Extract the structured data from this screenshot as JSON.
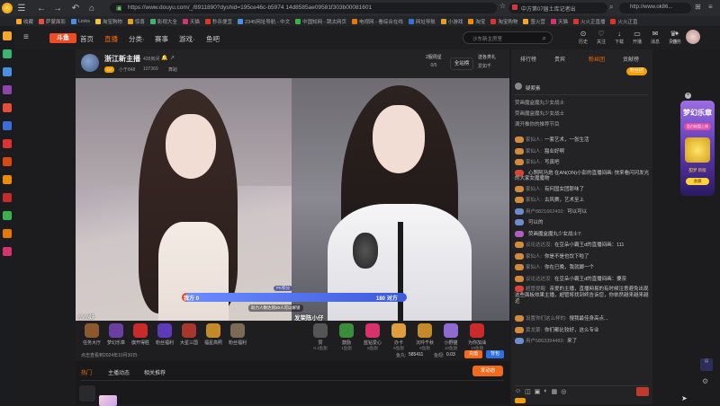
{
  "browser": {
    "url": "https://www.douyu.com/_/8911890?dyshid=195ce46c-b5974 14d8585ae09581f303b00081601",
    "search_placeholder": "中方第07届土库记者出",
    "ext_url": "http://www.ok86...",
    "bookmarks": [
      "收藏",
      "萨蒙面影",
      "Links",
      "淘宝购物",
      "惊喜",
      "影视大全",
      "天猫",
      "秒杀便宜",
      "2345网址导航 - 中文",
      "中国知网 - 跳太网页",
      "电视网 - 看综合在线",
      "网址导航",
      "小游戏",
      "淘宝",
      "淘宝购物",
      "萤火营",
      "天猫",
      "火火正直播",
      "火火正直"
    ]
  },
  "site": {
    "logo": "斗鱼",
    "nav": [
      {
        "label": "首页"
      },
      {
        "label": "直播"
      },
      {
        "label": "分类·"
      },
      {
        "label": "赛事"
      },
      {
        "label": "游戏·"
      },
      {
        "label": "鱼吧"
      }
    ],
    "search_placeholder": "沙东新主房室",
    "header_icons": [
      {
        "glyph": "⊙",
        "label": "历史"
      },
      {
        "glyph": "♡",
        "label": "关注"
      },
      {
        "glyph": "↓",
        "label": "下载"
      },
      {
        "glyph": "▭",
        "label": "开播"
      },
      {
        "glyph": "✉",
        "label": "消息"
      },
      {
        "glyph": "♛",
        "label": "贵族"
      },
      {
        "glyph": "✦",
        "label": "任务"
      }
    ]
  },
  "streamer": {
    "name": "浙江新主播",
    "room_num": "438房间",
    "followers": "小于848",
    "hot": "107369",
    "tag": "舞蹈",
    "rank_label": "2服周星",
    "rank_value": "0/5",
    "all_site": "全站榜",
    "gift_label": "送各类礼",
    "gift_value": "爱如千"
  },
  "video": {
    "pk_left_label": "我方",
    "pk_left_value": "0",
    "pk_right_value": "180",
    "pk_right_label": "对方",
    "pk_mid": "助力人数达到20人可以解锁",
    "pk_top": "PK积分",
    "caption_left": "小小妖",
    "caption_right": "发荣陈小仔"
  },
  "gifts_left": [
    {
      "name": "任务大厅"
    },
    {
      "name": "梦幻乐章"
    },
    {
      "name": "旗开得胜"
    },
    {
      "name": "粉丝福利"
    },
    {
      "name": "大星三国"
    },
    {
      "name": "福星高照"
    },
    {
      "name": "粉丝福利"
    }
  ],
  "gifts_right": [
    {
      "name": "赞",
      "price": "0.1鱼翅"
    },
    {
      "name": "鼓励",
      "price": "1鱼翅"
    },
    {
      "name": "蓝钻爱心",
      "price": "6鱼翅"
    },
    {
      "name": "办卡",
      "price": "6鱼翅"
    },
    {
      "name": "沉吟千秋",
      "price": "6鱼翅"
    },
    {
      "name": "小野猫",
      "price": "10鱼翅"
    },
    {
      "name": "为你加油",
      "price": "10鱼翅"
    }
  ],
  "wallet": {
    "tips": "点击查看到2024年10月30日·",
    "fish_ball_label": "鱼丸:",
    "fish_ball": "585411",
    "fish_fin_label": "鱼翅:",
    "fish_fin": "0.03",
    "recharge": "充值",
    "backpack": "背包"
  },
  "lower_tabs": [
    {
      "label": "热门"
    },
    {
      "label": "主播动态"
    },
    {
      "label": "相关推荐"
    }
  ],
  "lower_button": "发动态",
  "panel": {
    "tabs": [
      {
        "label": "排行榜"
      },
      {
        "label": "贵宾"
      },
      {
        "label": "粉丝团"
      },
      {
        "label": "贡献榜"
      }
    ],
    "tabs_active": "粉丝团",
    "fav_btn": "粉丝团",
    "fans_label": "疑萦素",
    "notices": [
      "荧画魔盒魔丸少女战士 ",
      "荧画魔盒魔丸少女战士",
      "满开推你的推荐节目"
    ],
    "chats": [
      {
        "lv": "#d28a3f",
        "nick": "家仙人:",
        "text": "一套艺术，一张生活"
      },
      {
        "lv": "#d28a3f",
        "nick": "家仙人:",
        "text": "豁业好啊"
      },
      {
        "lv": "#d28a3f",
        "nick": "家仙人:",
        "text": "写真吧"
      },
      {
        "lv": "#d5453b",
        "nick": "",
        "text": "心照阿冯炮 在AN(ON)小彭的直播间画: 快来看闪闪发光的大家女魔魔物"
      },
      {
        "lv": "#d28a3f",
        "nick": "家仙人:",
        "text": "有何国女团那味了"
      },
      {
        "lv": "#d28a3f",
        "nick": "家仙人:",
        "text": "古风赛，艺术至上"
      },
      {
        "lv": "#6f8bd0",
        "nick": "用户8821662492:",
        "text": "可以可以"
      },
      {
        "lv": "#6f8bd0",
        "nick": "",
        "text": "可以的"
      },
      {
        "lv": "#b15dc4",
        "nick": "",
        "text": "荧画魔盒魔丸少女战士7:"
      },
      {
        "lv": "#d28a3f",
        "nick": "议论达达没:",
        "text": "在豆朵小霸王d的直播间画：111"
      },
      {
        "lv": "#d28a3f",
        "nick": "家仙人:",
        "text": "你是不是也饮下啦了"
      },
      {
        "lv": "#d28a3f",
        "nick": "家仙人:",
        "text": "你在已晚，我就脚一个"
      },
      {
        "lv": "#d28a3f",
        "nick": "议论达达没:",
        "text": "在豆朵小霸王d的直播间画：要奈"
      },
      {
        "lv": "#d5453b",
        "nick": "超管提醒:",
        "text": "亲爱的主播，直播网易的有时候注意避免出现这些面板效果主播，超管将找到终告诉您，你依然越来越来越近"
      },
      {
        "lv": "#d28a3f",
        "nick": "设置你们这么样的:",
        "text": "搜我最佳身高点..."
      },
      {
        "lv": "#d28a3f",
        "nick": "黄龙蒙:",
        "text": "你们都比较好，这么专业"
      },
      {
        "lv": "#6f8bd0",
        "nick": "用户5863394483:",
        "text": "来了"
      }
    ]
  },
  "promo": {
    "title": "梦幻乐章",
    "subtitle": "告白轮盘上线",
    "badge": "甜梦 新版",
    "btn": "收藏"
  },
  "colors": {
    "accent": "#ff6a00",
    "pk_left": "#e4492c",
    "pk_right": "#3b5bdb"
  }
}
